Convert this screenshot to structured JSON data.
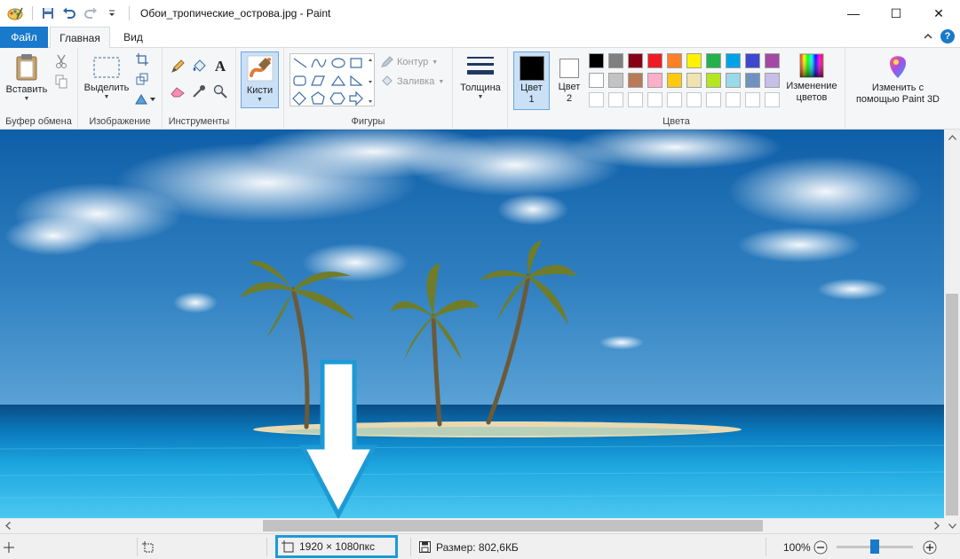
{
  "window": {
    "title": "Обои_тропические_острова.jpg - Paint",
    "minimize": "—",
    "maximize": "☐",
    "close": "✕"
  },
  "tabs": {
    "file": "Файл",
    "home": "Главная",
    "view": "Вид"
  },
  "help_label": "?",
  "ribbon": {
    "clipboard": {
      "label": "Буфер обмена",
      "paste": "Вставить"
    },
    "image": {
      "label": "Изображение",
      "select": "Выделить"
    },
    "tools": {
      "label": "Инструменты",
      "text_tool": "A"
    },
    "brushes": {
      "label": "Кисти"
    },
    "shapes": {
      "label": "Фигуры",
      "outline": "Контур",
      "fill": "Заливка"
    },
    "size": {
      "label": "Толщина"
    },
    "colors": {
      "label": "Цвета",
      "color1_line1": "Цвет",
      "color1_line2": "1",
      "color2_line1": "Цвет",
      "color2_line2": "2",
      "color1": "#000000",
      "color2": "#ffffff",
      "palette_row1": [
        "#000000",
        "#7f7f7f",
        "#880015",
        "#ed1c24",
        "#ff7f27",
        "#fff200",
        "#22b14c",
        "#00a2e8",
        "#3f48cc",
        "#a349a4"
      ],
      "palette_row2": [
        "#ffffff",
        "#c3c3c3",
        "#b97a57",
        "#ffaec9",
        "#ffc90e",
        "#efe4b0",
        "#b5e61d",
        "#99d9ea",
        "#7092be",
        "#c8bfe7"
      ],
      "edit_line1": "Изменение",
      "edit_line2": "цветов"
    },
    "paint3d": {
      "line1": "Изменить с",
      "line2": "помощью Paint 3D"
    }
  },
  "status": {
    "dimensions": "1920 × 1080пкс",
    "size": "Размер: 802,6КБ",
    "zoom": "100%",
    "zoom_level_fraction": 0.5
  },
  "accent": "#1979ca",
  "highlight": "#1c9ad6"
}
